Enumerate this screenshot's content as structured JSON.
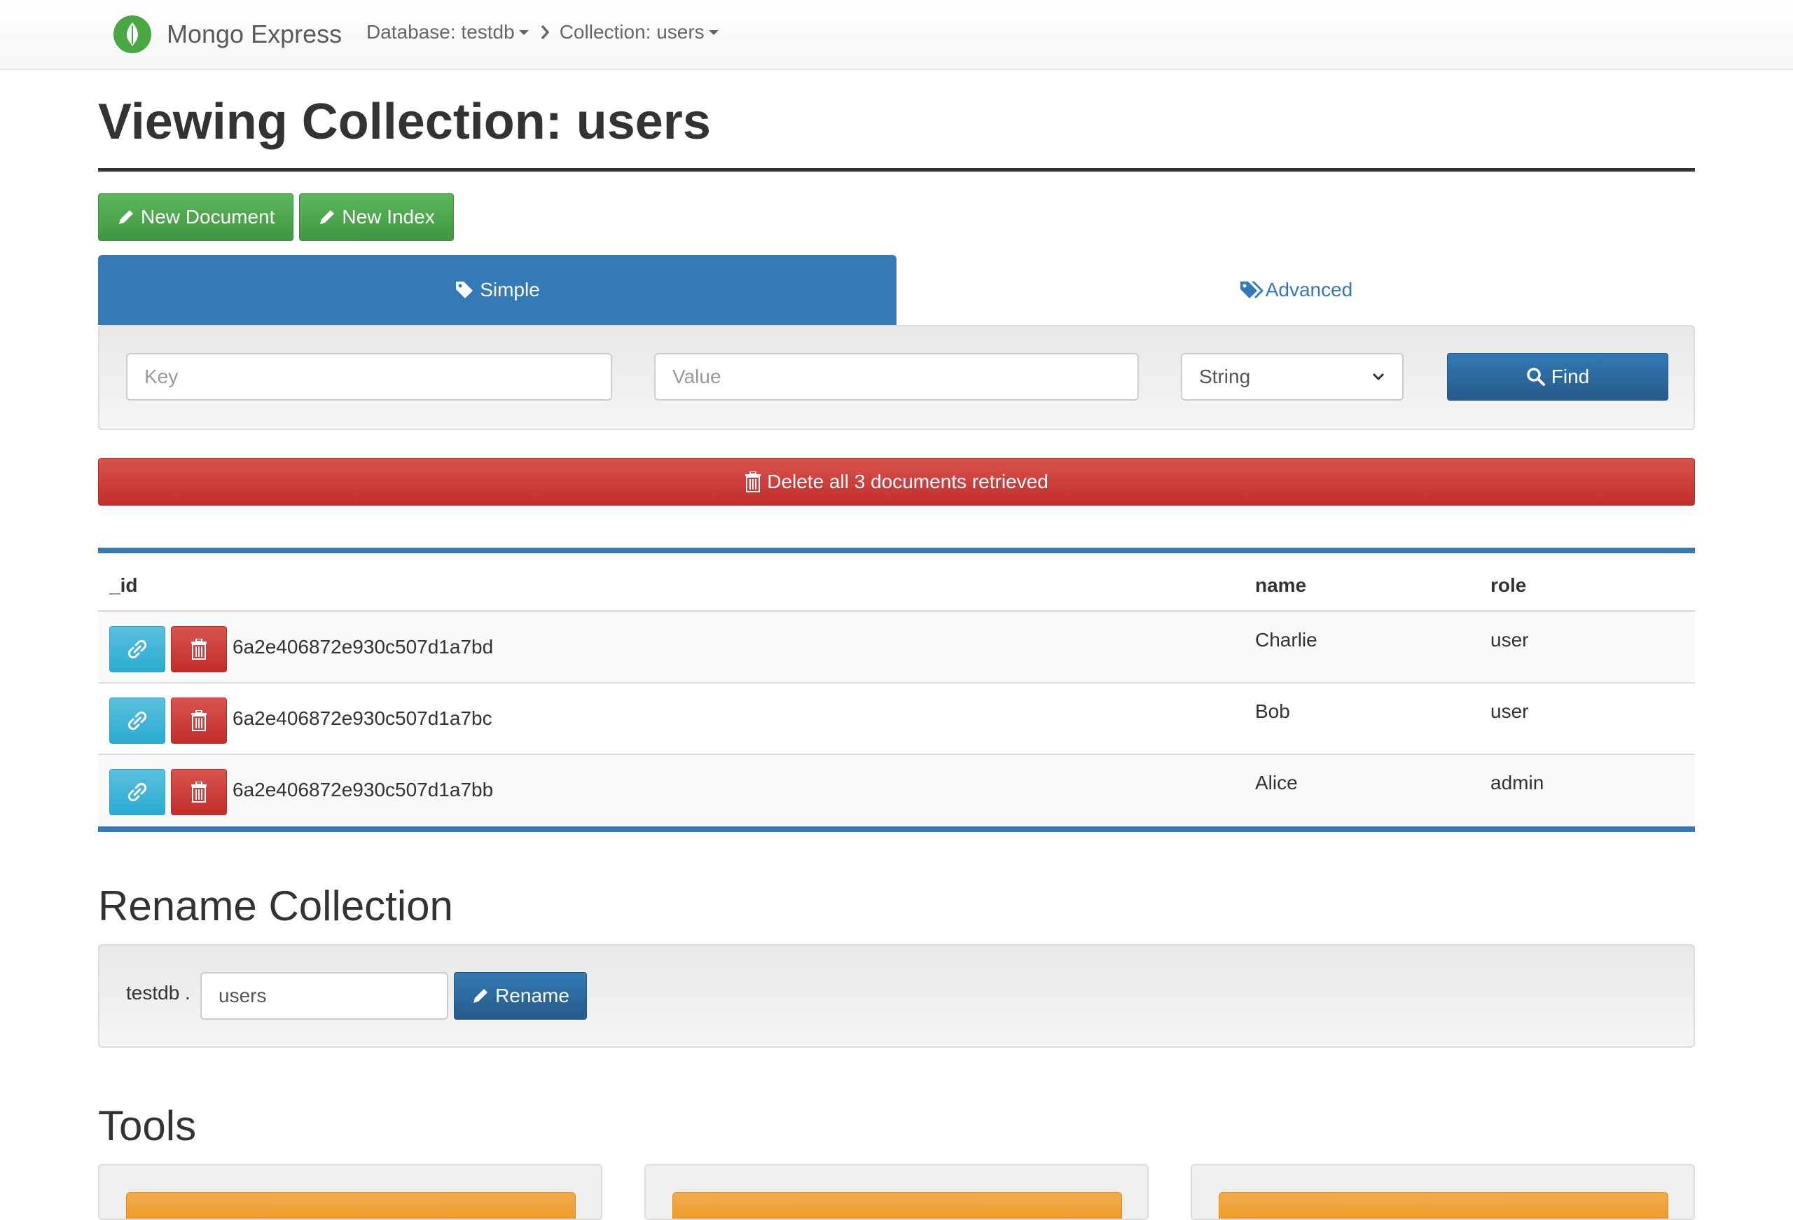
{
  "navbar": {
    "brand": "Mongo Express",
    "crumbs": [
      {
        "label": "Database: testdb"
      },
      {
        "label": "Collection: users"
      }
    ]
  },
  "page": {
    "title": "Viewing Collection: users"
  },
  "actions": {
    "new_document": "New Document",
    "new_index": "New Index"
  },
  "tabs": {
    "simple": "Simple",
    "advanced": "Advanced"
  },
  "search": {
    "key_placeholder": "Key",
    "value_placeholder": "Value",
    "type_selected": "String",
    "find_label": "Find"
  },
  "delete_all_label": "Delete all 3 documents retrieved",
  "table": {
    "columns": [
      "_id",
      "name",
      "role"
    ],
    "rows": [
      {
        "id": "6a2e406872e930c507d1a7bd",
        "name": "Charlie",
        "role": "user"
      },
      {
        "id": "6a2e406872e930c507d1a7bc",
        "name": "Bob",
        "role": "user"
      },
      {
        "id": "6a2e406872e930c507d1a7bb",
        "name": "Alice",
        "role": "admin"
      }
    ]
  },
  "rename": {
    "heading": "Rename Collection",
    "db_prefix": "testdb .",
    "input_value": "users",
    "button_label": "Rename"
  },
  "tools": {
    "heading": "Tools"
  },
  "colors": {
    "primary": "#337ab7",
    "success": "#5cb85c",
    "danger": "#d9534f",
    "info": "#5bc0de",
    "warning": "#f0ad4e"
  }
}
